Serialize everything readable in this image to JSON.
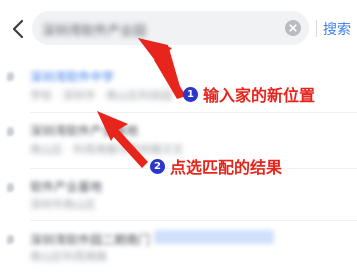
{
  "header": {
    "search_query": "深圳湾软件产业园",
    "search_button": "搜索"
  },
  "results": [
    {
      "title": "深圳湾软件中学",
      "subtitle": "学校 · 深圳市 · 南山区科技园"
    },
    {
      "title": "深圳湾软件产业基地",
      "subtitle": "南山区 · 科苑南路与学府路交叉"
    },
    {
      "title": "软件产业基地",
      "subtitle": "深圳市南山区"
    },
    {
      "title": "深圳湾软件园二期南门",
      "subtitle": "南山区科苑南路"
    }
  ],
  "annotations": [
    {
      "number": "1",
      "text": "输入家的新位置"
    },
    {
      "number": "2",
      "text": "点选匹配的结果"
    }
  ],
  "colors": {
    "accent_blue": "#3d7fe8",
    "annotation_red": "#e8251c",
    "badge_blue": "#2b37c9"
  }
}
